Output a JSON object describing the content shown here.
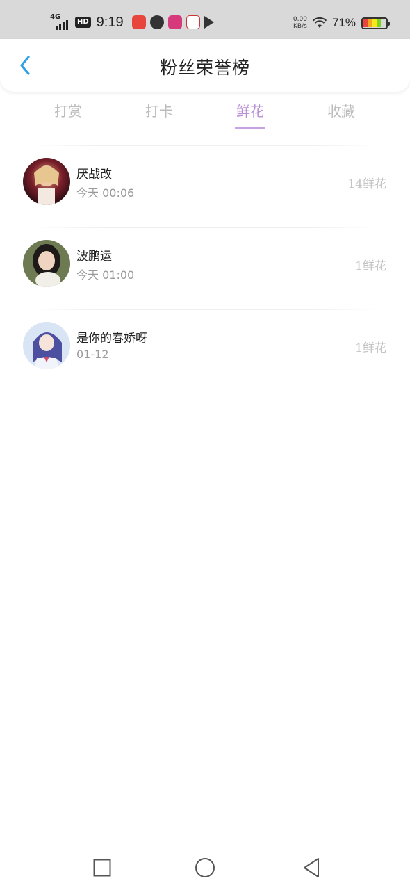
{
  "status_bar": {
    "network": "4G",
    "hd": "HD",
    "time": "9:19",
    "speed_value": "0.00",
    "speed_unit": "KB/s",
    "battery_percent": "71%",
    "battery_level": 0.71,
    "app_icons": [
      "app-notification-icon",
      "clock-app-icon",
      "app-notification-icon",
      "app-notification-icon",
      "play-icon"
    ]
  },
  "header": {
    "title": "粉丝荣誉榜",
    "back_icon": "chevron-left-icon",
    "accent_color": "#2ea0e6"
  },
  "tabs": [
    {
      "label": "打赏",
      "active": false
    },
    {
      "label": "打卡",
      "active": false
    },
    {
      "label": "鲜花",
      "active": true
    },
    {
      "label": "收藏",
      "active": false
    }
  ],
  "active_tab_color": "#b98fd6",
  "fans": [
    {
      "name": "厌战改",
      "time": "今天 00:06",
      "count": "14鲜花"
    },
    {
      "name": "波鹏运",
      "time": "今天 01:00",
      "count": "1鲜花"
    },
    {
      "name": "是你的春娇呀",
      "time": "01-12",
      "count": "1鲜花"
    }
  ],
  "nav": {
    "recent": "square-icon",
    "home": "circle-icon",
    "back": "triangle-back-icon"
  }
}
